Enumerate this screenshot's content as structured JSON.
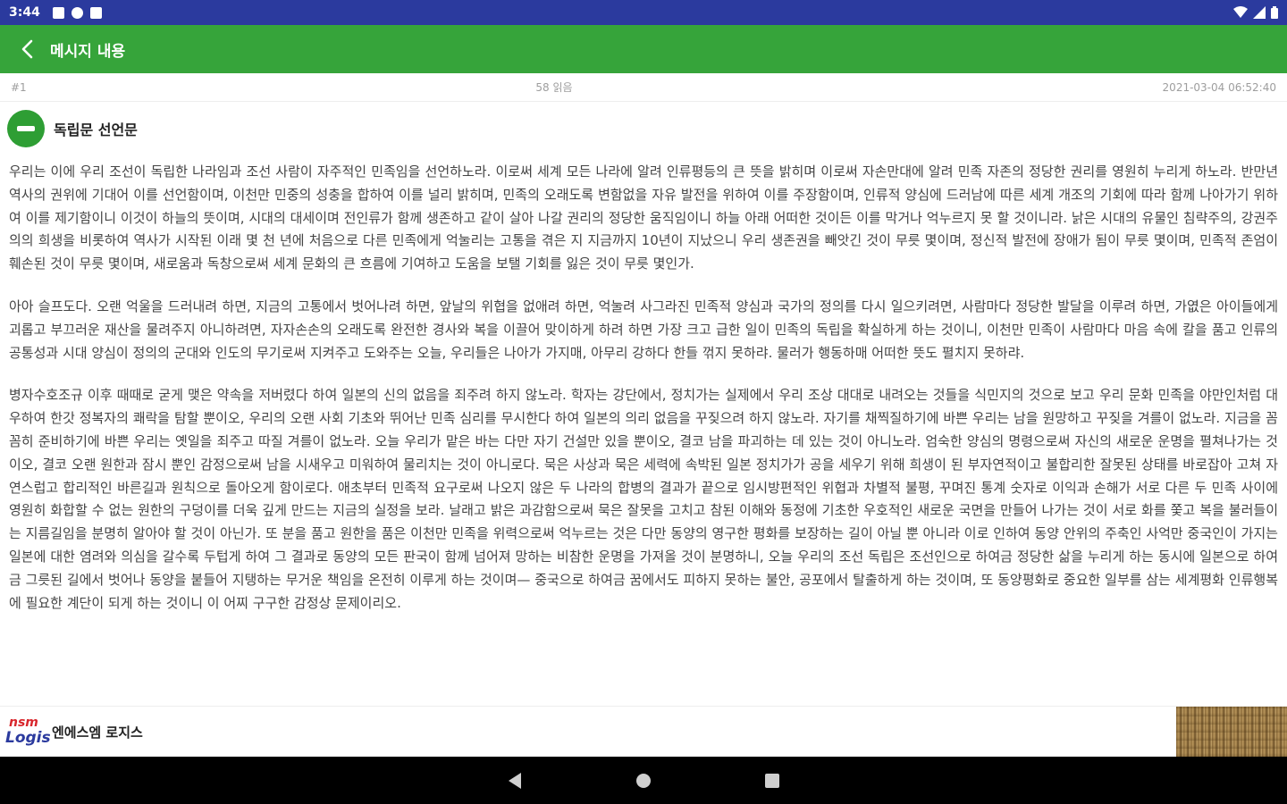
{
  "status_bar": {
    "time": "3:44",
    "left_icons": [
      "notification-square-icon",
      "p-badge-icon",
      "sd-card-icon"
    ],
    "right_icons": [
      "wifi-icon",
      "signal-icon",
      "battery-icon"
    ]
  },
  "app_bar": {
    "title": "메시지 내용"
  },
  "meta": {
    "number": "#1",
    "views": "58 읽음",
    "datetime": "2021-03-04 06:52:40"
  },
  "message": {
    "title": "독립문 선언문",
    "paragraphs": [
      "우리는 이에 우리 조선이 독립한 나라임과 조선 사람이 자주적인 민족임을 선언하노라. 이로써 세계 모든 나라에 알려 인류평등의 큰 뜻을 밝히며 이로써 자손만대에 알려 민족 자존의 정당한 권리를 영원히 누리게 하노라. 반만년 역사의 권위에 기대어 이를 선언함이며, 이천만 민중의 성충을 합하여 이를 널리 밝히며, 민족의 오래도록 변함없을 자유 발전을 위하여 이를 주장함이며, 인류적 양심에 드러남에 따른 세계 개조의 기회에 따라 함께 나아가기 위하여 이를 제기함이니 이것이 하늘의 뜻이며, 시대의 대세이며 전인류가 함께 생존하고 같이 살아 나갈 권리의 정당한 움직임이니 하늘 아래 어떠한 것이든 이를 막거나 억누르지 못 할 것이니라. 낡은 시대의 유물인 침략주의, 강권주의의 희생을 비롯하여 역사가 시작된 이래 몇 천 년에 처음으로 다른 민족에게 억눌리는 고통을 겪은 지 지금까지 10년이 지났으니 우리 생존권을 빼앗긴 것이 무릇 몇이며, 정신적 발전에 장애가 됨이 무릇 몇이며, 민족적 존엄이 훼손된 것이 무릇 몇이며, 새로움과 독창으로써 세계 문화의 큰 흐름에 기여하고 도움을 보탤 기회를 잃은 것이 무릇 몇인가.",
      "아아 슬프도다. 오랜 억울을 드러내려 하면, 지금의 고통에서 벗어나려 하면, 앞날의 위협을 없애려 하면, 억눌려 사그라진 민족적 양심과 국가의 정의를 다시 일으키려면, 사람마다 정당한 발달을 이루려 하면, 가엾은 아이들에게 괴롭고 부끄러운 재산을 물려주지 아니하려면, 자자손손의 오래도록 완전한 경사와 복을 이끌어 맞이하게 하려 하면 가장 크고 급한 일이 민족의 독립을 확실하게 하는 것이니, 이천만 민족이 사람마다 마음 속에 칼을 품고 인류의 공통성과 시대 양심이 정의의 군대와 인도의 무기로써 지켜주고 도와주는 오늘, 우리들은 나아가 가지매, 아무리 강하다 한들 꺾지 못하랴. 물러가 행동하매 어떠한 뜻도 펼치지 못하랴.",
      "병자수호조규 이후 때때로 굳게 맺은 약속을 저버렸다 하여 일본의 신의 없음을 죄주려 하지 않노라. 학자는 강단에서, 정치가는 실제에서 우리 조상 대대로 내려오는 것들을 식민지의 것으로 보고 우리 문화 민족을 야만인처럼 대우하여 한갓 정복자의 쾌락을 탐할 뿐이오, 우리의 오랜 사회 기초와 뛰어난 민족 심리를 무시한다 하여 일본의 의리 없음을 꾸짖으려 하지 않노라. 자기를 채찍질하기에 바쁜 우리는 남을 원망하고 꾸짖을 겨를이 없노라. 지금을 꼼꼼히 준비하기에 바쁜 우리는 옛일을 죄주고 따질 겨를이 없노라. 오늘 우리가 맡은 바는 다만 자기 건설만 있을 뿐이오, 결코 남을 파괴하는 데 있는 것이 아니노라. 엄숙한 양심의 명령으로써 자신의 새로운 운명을 펼쳐나가는 것이오, 결코 오랜 원한과 잠시 뿐인 감정으로써 남을 시새우고 미워하여 물리치는 것이 아니로다. 묵은 사상과 묵은 세력에 속박된 일본 정치가가 공을 세우기 위해 희생이 된 부자연적이고 불합리한 잘못된 상태를 바로잡아 고쳐 자연스럽고 합리적인 바른길과 원칙으로 돌아오게 함이로다. 애초부터 민족적 요구로써 나오지 않은 두 나라의 합병의 결과가 끝으로 임시방편적인 위협과 차별적 불평, 꾸며진 통계 숫자로 이익과 손해가 서로 다른 두 민족 사이에 영원히 화합할 수 없는 원한의 구덩이를 더욱 깊게 만드는 지금의 실정을 보라. 날래고 밝은 과감함으로써 묵은 잘못을 고치고 참된 이해와 동정에 기초한 우호적인 새로운 국면을 만들어 나가는 것이 서로 화를 쫓고 복을 불러들이는 지름길임을 분명히 알아야 할 것이 아닌가. 또 분을 품고 원한을 품은 이천만 민족을 위력으로써 억누르는 것은 다만 동양의 영구한 평화를 보장하는 길이 아닐 뿐 아니라 이로 인하여 동양 안위의 주축인 사억만 중국인이 가지는 일본에 대한 염려와 의심을 갈수록 두텁게 하여 그 결과로 동양의 모든 판국이 함께 넘어져 망하는 비참한 운명을 가져올 것이 분명하니, 오늘 우리의 조선 독립은 조선인으로 하여금 정당한 삶을 누리게 하는 동시에 일본으로 하여금 그릇된 길에서 벗어나 동양을 붙들어 지탱하는 무거운 책임을 온전히 이루게 하는 것이며— 중국으로 하여금 꿈에서도 피하지 못하는 불안, 공포에서 탈출하게 하는 것이며, 또 동양평화로 중요한 일부를 삼는 세계평화 인류행복에 필요한 계단이 되게 하는 것이니 이 어찌 구구한 감정상 문제이리오."
    ]
  },
  "footer": {
    "logo_top": "nsm",
    "logo_bottom": "Logis",
    "company_name": "엔에스엠 로지스"
  }
}
